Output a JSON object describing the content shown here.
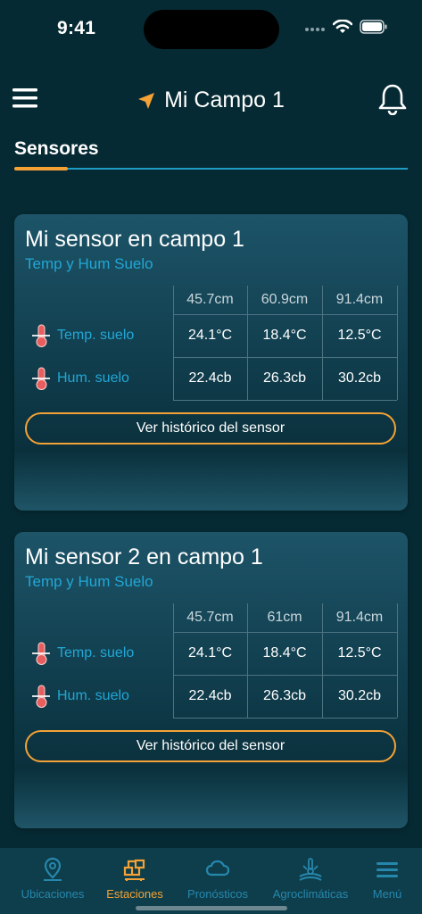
{
  "status_bar": {
    "time": "9:41"
  },
  "header": {
    "title": "Mi Campo 1"
  },
  "section": {
    "title": "Sensores"
  },
  "colors": {
    "accent": "#f4a236",
    "link": "#22a7d6",
    "background": "#062a33"
  },
  "sensors": [
    {
      "name": "Mi sensor en campo 1",
      "type": "Temp y Hum Suelo",
      "depths": [
        "45.7cm",
        "60.9cm",
        "91.4cm"
      ],
      "rows": [
        {
          "label": "Temp. suelo",
          "icon": "thermometer-icon",
          "values": [
            "24.1°C",
            "18.4°C",
            "12.5°C"
          ]
        },
        {
          "label": "Hum. suelo",
          "icon": "thermometer-icon",
          "values": [
            "22.4cb",
            "26.3cb",
            "30.2cb"
          ]
        }
      ],
      "button": "Ver histórico del sensor"
    },
    {
      "name": "Mi sensor 2 en campo 1",
      "type": "Temp y Hum Suelo",
      "depths": [
        "45.7cm",
        "61cm",
        "91.4cm"
      ],
      "rows": [
        {
          "label": "Temp. suelo",
          "icon": "thermometer-icon",
          "values": [
            "24.1°C",
            "18.4°C",
            "12.5°C"
          ]
        },
        {
          "label": "Hum. suelo",
          "icon": "thermometer-icon",
          "values": [
            "22.4cb",
            "26.3cb",
            "30.2cb"
          ]
        }
      ],
      "button": "Ver histórico del sensor"
    }
  ],
  "nav": {
    "active": "Estaciones",
    "items": [
      {
        "label": "Ubicaciones",
        "icon": "location-pin-icon"
      },
      {
        "label": "Estaciones",
        "icon": "stations-icon"
      },
      {
        "label": "Pronósticos",
        "icon": "cloud-icon"
      },
      {
        "label": "Agroclimáticas",
        "icon": "agro-icon"
      },
      {
        "label": "Menú",
        "icon": "hamburger-icon"
      }
    ]
  }
}
